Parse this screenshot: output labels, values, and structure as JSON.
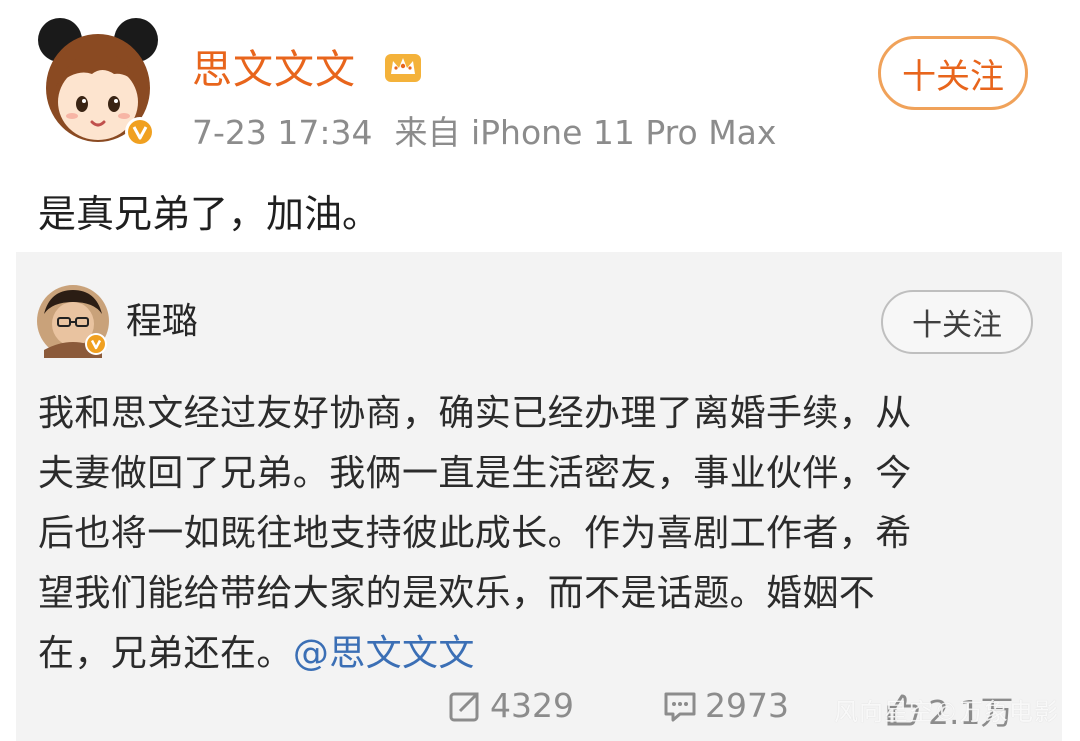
{
  "post": {
    "username": "思文文文",
    "timestamp": "7-23 17:34",
    "source": "来自 iPhone 11 Pro Max",
    "follow_label": "十关注",
    "text": "是真兄弟了，加油。",
    "colors": {
      "username": "#e8651c",
      "verified": "#f0a020"
    }
  },
  "repost": {
    "username": "程璐",
    "follow_label": "十关注",
    "text_lines": [
      "我和思文经过友好协商，确实已经办理了离婚手续，从",
      "夫妻做回了兄弟。我俩一直是生活密友，事业伙伴，今",
      "后也将一如既往地支持彼此成长。作为喜剧工作者，希",
      "望我们能给带给大家的是欢乐，而不是话题。婚姻不",
      "在，兄弟还在。"
    ],
    "mention": "@思文文文",
    "stats": {
      "reposts": "4329",
      "comments": "2973",
      "likes": "2.1万"
    }
  },
  "watermark": "风向星空©万象电影",
  "icons": {
    "verified": "verified-badge-icon",
    "crown": "crown-icon",
    "repost": "repost-icon",
    "comment": "comment-icon",
    "like": "thumbs-up-icon"
  }
}
